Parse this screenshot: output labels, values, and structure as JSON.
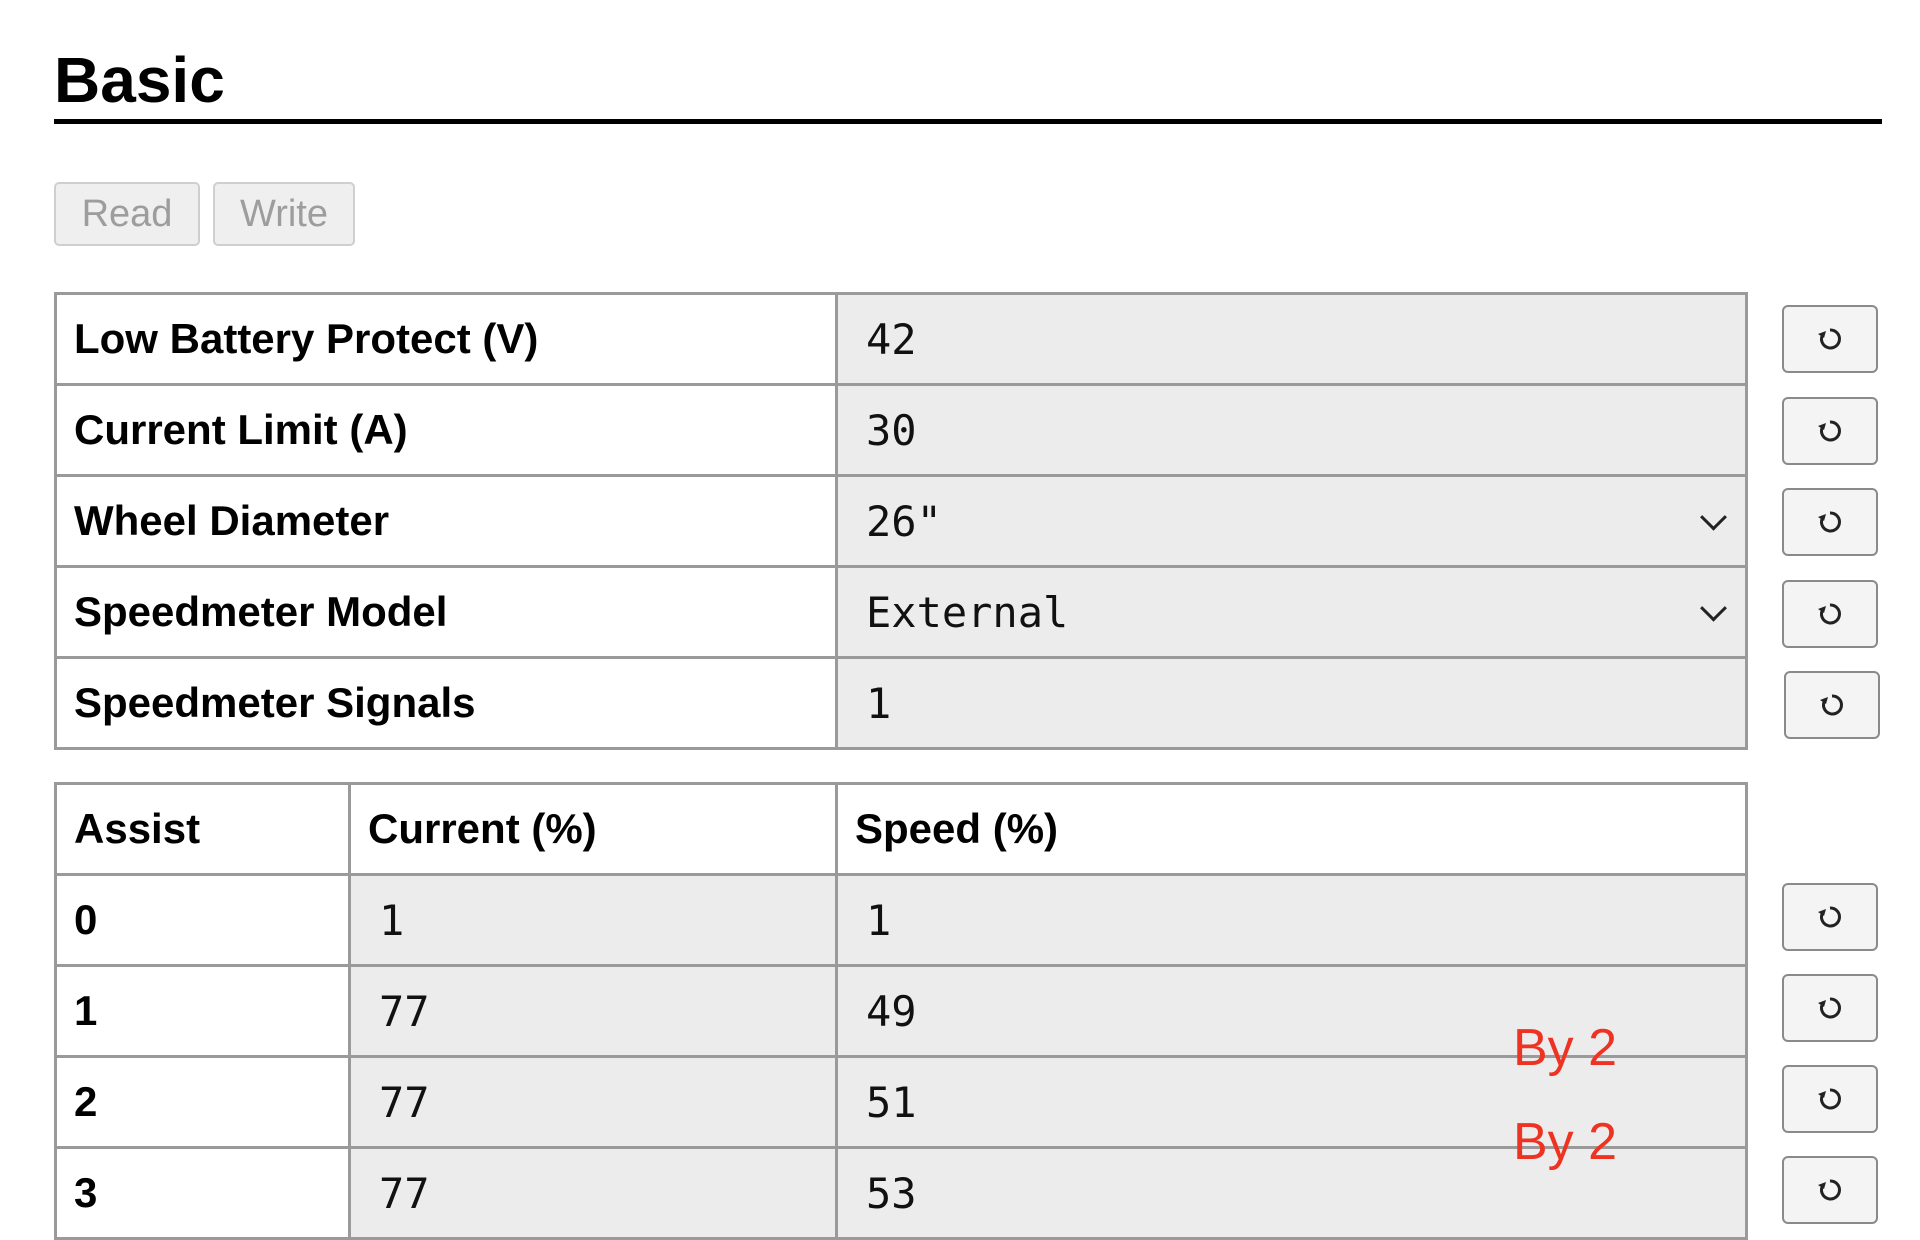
{
  "page": {
    "title": "Basic"
  },
  "toolbar": {
    "read_label": "Read",
    "write_label": "Write"
  },
  "settings": [
    {
      "label": "Low Battery Protect (V)",
      "value": "42",
      "type": "input"
    },
    {
      "label": "Current Limit (A)",
      "value": "30",
      "type": "input"
    },
    {
      "label": "Wheel Diameter",
      "value": "26\"",
      "type": "select"
    },
    {
      "label": "Speedmeter Model",
      "value": "External",
      "type": "select"
    },
    {
      "label": "Speedmeter Signals",
      "value": "1",
      "type": "input"
    }
  ],
  "assist": {
    "headers": [
      "Assist",
      "Current (%)",
      "Speed (%)"
    ],
    "rows": [
      {
        "level": "0",
        "current": "1",
        "speed": "1"
      },
      {
        "level": "1",
        "current": "77",
        "speed": "49"
      },
      {
        "level": "2",
        "current": "77",
        "speed": "51"
      },
      {
        "level": "3",
        "current": "77",
        "speed": "53"
      }
    ]
  },
  "annotations": [
    "By 2",
    "By 2"
  ],
  "colors": {
    "annotation": "#ee3322",
    "field_bg": "#ececec",
    "border": "#9a9a9a"
  },
  "icons": {
    "refresh": "refresh-icon",
    "dropdown": "chevron-down-icon"
  }
}
